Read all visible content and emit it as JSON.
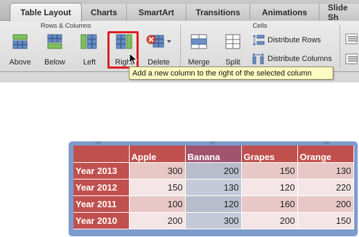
{
  "tabs": [
    {
      "label": "Table Layout",
      "active": true
    },
    {
      "label": "Charts",
      "active": false
    },
    {
      "label": "SmartArt",
      "active": false
    },
    {
      "label": "Transitions",
      "active": false
    },
    {
      "label": "Animations",
      "active": false
    },
    {
      "label": "Slide Sh",
      "active": false
    }
  ],
  "ribbon": {
    "rows_columns_label": "Rows & Columns",
    "cells_label": "Cells",
    "buttons": {
      "above": "Above",
      "below": "Below",
      "left": "Left",
      "right": "Right",
      "delete": "Delete",
      "merge": "Merge",
      "split": "Split",
      "distribute_rows": "Distribute Rows",
      "distribute_columns": "Distribute Columns"
    }
  },
  "tooltip": "Add a new column to the right of the selected column",
  "table": {
    "headers": [
      "",
      "Apple",
      "Banana",
      "Grapes",
      "Orange"
    ],
    "rows": [
      {
        "label": "Year 2013",
        "values": [
          "300",
          "200",
          "150",
          "130"
        ]
      },
      {
        "label": "Year 2012",
        "values": [
          "150",
          "130",
          "120",
          "220"
        ]
      },
      {
        "label": "Year 2011",
        "values": [
          "100",
          "120",
          "160",
          "200"
        ]
      },
      {
        "label": "Year 2010",
        "values": [
          "200",
          "300",
          "200",
          "150"
        ]
      }
    ],
    "selected_column": "Banana"
  },
  "colors": {
    "header_red": "#c0504d",
    "selection_blue": "#7d9ccc",
    "tooltip_bg": "#fffcc2",
    "highlight_red": "#e01a1a"
  }
}
